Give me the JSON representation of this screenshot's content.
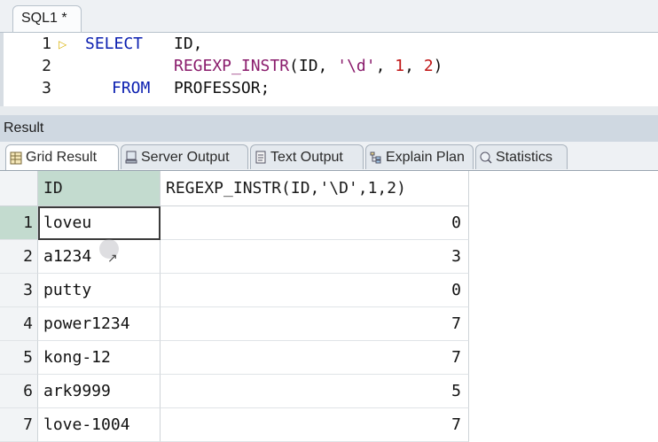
{
  "editor_tab": {
    "label": "SQL1 *"
  },
  "editor": {
    "lines": [
      {
        "no": "1",
        "tokens": [
          "SELECT",
          "ID,"
        ]
      },
      {
        "no": "2",
        "tokens": [
          "REGEXP_INSTR",
          "(ID, ",
          "'\\d'",
          ", ",
          "1",
          ", ",
          "2",
          ")"
        ]
      },
      {
        "no": "3",
        "tokens": [
          "FROM",
          "PROFESSOR;"
        ]
      }
    ]
  },
  "result": {
    "title": "Result",
    "tabs": [
      {
        "label": "Grid Result",
        "icon": "grid-icon",
        "active": true
      },
      {
        "label": "Server Output",
        "icon": "server-output-icon",
        "active": false
      },
      {
        "label": "Text Output",
        "icon": "text-output-icon",
        "active": false
      },
      {
        "label": "Explain Plan",
        "icon": "explain-plan-icon",
        "active": false
      },
      {
        "label": "Statistics",
        "icon": "statistics-icon",
        "active": false
      }
    ],
    "columns": [
      "ID",
      "REGEXP_INSTR(ID,'\\D',1,2)"
    ],
    "rows": [
      {
        "n": "1",
        "id": "loveu",
        "val": "0"
      },
      {
        "n": "2",
        "id": "a1234",
        "val": "3"
      },
      {
        "n": "3",
        "id": "putty",
        "val": "0"
      },
      {
        "n": "4",
        "id": "power1234",
        "val": "7"
      },
      {
        "n": "5",
        "id": "kong-12",
        "val": "7"
      },
      {
        "n": "6",
        "id": "ark9999",
        "val": "5"
      },
      {
        "n": "7",
        "id": "love-1004",
        "val": "7"
      }
    ]
  },
  "colors": {
    "keyword": "#0b1fb0",
    "function": "#8a1c6c",
    "number": "#c01515",
    "selected": "#c3dbcf"
  }
}
